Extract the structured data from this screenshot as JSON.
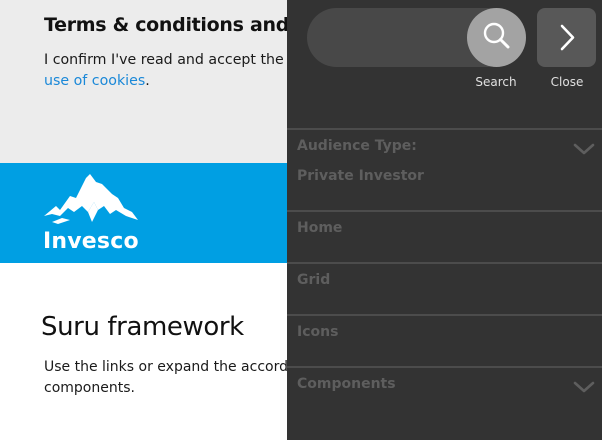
{
  "background": {
    "terms": {
      "title": "Terms & conditions and cookie",
      "text_line1": "I confirm I've read and accept the site",
      "link": "use of cookies",
      "text_end": "."
    },
    "brand": {
      "logo_text": "Invesco",
      "brand_color": "#009fe3"
    },
    "suru": {
      "title": "Suru framework",
      "text_line1": "Use the links or expand the accordion",
      "text_line2": "components."
    }
  },
  "drawer": {
    "search": {
      "value": "",
      "placeholder": "",
      "button_label": "Search",
      "icon": "search-icon"
    },
    "close": {
      "button_label": "Close",
      "icon": "chevron-right-icon"
    },
    "nav": {
      "audience_label": "Audience Type:",
      "audience_value": "Private Investor",
      "items": [
        {
          "label": "Home"
        },
        {
          "label": "Grid"
        },
        {
          "label": "Icons"
        },
        {
          "label": "Components"
        }
      ]
    },
    "colors": {
      "background": "#333333",
      "divider": "#4c4c4c",
      "muted_text": "#5e5e5e"
    }
  }
}
